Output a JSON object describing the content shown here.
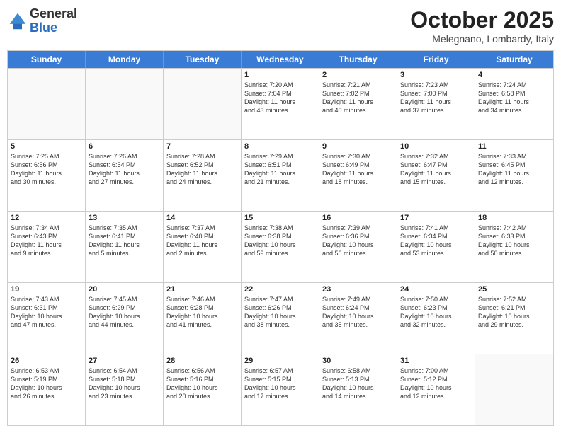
{
  "header": {
    "logo_line1": "General",
    "logo_line2": "Blue",
    "month_title": "October 2025",
    "location": "Melegnano, Lombardy, Italy"
  },
  "weekdays": [
    "Sunday",
    "Monday",
    "Tuesday",
    "Wednesday",
    "Thursday",
    "Friday",
    "Saturday"
  ],
  "weeks": [
    [
      {
        "day": "",
        "info": ""
      },
      {
        "day": "",
        "info": ""
      },
      {
        "day": "",
        "info": ""
      },
      {
        "day": "1",
        "info": "Sunrise: 7:20 AM\nSunset: 7:04 PM\nDaylight: 11 hours\nand 43 minutes."
      },
      {
        "day": "2",
        "info": "Sunrise: 7:21 AM\nSunset: 7:02 PM\nDaylight: 11 hours\nand 40 minutes."
      },
      {
        "day": "3",
        "info": "Sunrise: 7:23 AM\nSunset: 7:00 PM\nDaylight: 11 hours\nand 37 minutes."
      },
      {
        "day": "4",
        "info": "Sunrise: 7:24 AM\nSunset: 6:58 PM\nDaylight: 11 hours\nand 34 minutes."
      }
    ],
    [
      {
        "day": "5",
        "info": "Sunrise: 7:25 AM\nSunset: 6:56 PM\nDaylight: 11 hours\nand 30 minutes."
      },
      {
        "day": "6",
        "info": "Sunrise: 7:26 AM\nSunset: 6:54 PM\nDaylight: 11 hours\nand 27 minutes."
      },
      {
        "day": "7",
        "info": "Sunrise: 7:28 AM\nSunset: 6:52 PM\nDaylight: 11 hours\nand 24 minutes."
      },
      {
        "day": "8",
        "info": "Sunrise: 7:29 AM\nSunset: 6:51 PM\nDaylight: 11 hours\nand 21 minutes."
      },
      {
        "day": "9",
        "info": "Sunrise: 7:30 AM\nSunset: 6:49 PM\nDaylight: 11 hours\nand 18 minutes."
      },
      {
        "day": "10",
        "info": "Sunrise: 7:32 AM\nSunset: 6:47 PM\nDaylight: 11 hours\nand 15 minutes."
      },
      {
        "day": "11",
        "info": "Sunrise: 7:33 AM\nSunset: 6:45 PM\nDaylight: 11 hours\nand 12 minutes."
      }
    ],
    [
      {
        "day": "12",
        "info": "Sunrise: 7:34 AM\nSunset: 6:43 PM\nDaylight: 11 hours\nand 9 minutes."
      },
      {
        "day": "13",
        "info": "Sunrise: 7:35 AM\nSunset: 6:41 PM\nDaylight: 11 hours\nand 5 minutes."
      },
      {
        "day": "14",
        "info": "Sunrise: 7:37 AM\nSunset: 6:40 PM\nDaylight: 11 hours\nand 2 minutes."
      },
      {
        "day": "15",
        "info": "Sunrise: 7:38 AM\nSunset: 6:38 PM\nDaylight: 10 hours\nand 59 minutes."
      },
      {
        "day": "16",
        "info": "Sunrise: 7:39 AM\nSunset: 6:36 PM\nDaylight: 10 hours\nand 56 minutes."
      },
      {
        "day": "17",
        "info": "Sunrise: 7:41 AM\nSunset: 6:34 PM\nDaylight: 10 hours\nand 53 minutes."
      },
      {
        "day": "18",
        "info": "Sunrise: 7:42 AM\nSunset: 6:33 PM\nDaylight: 10 hours\nand 50 minutes."
      }
    ],
    [
      {
        "day": "19",
        "info": "Sunrise: 7:43 AM\nSunset: 6:31 PM\nDaylight: 10 hours\nand 47 minutes."
      },
      {
        "day": "20",
        "info": "Sunrise: 7:45 AM\nSunset: 6:29 PM\nDaylight: 10 hours\nand 44 minutes."
      },
      {
        "day": "21",
        "info": "Sunrise: 7:46 AM\nSunset: 6:28 PM\nDaylight: 10 hours\nand 41 minutes."
      },
      {
        "day": "22",
        "info": "Sunrise: 7:47 AM\nSunset: 6:26 PM\nDaylight: 10 hours\nand 38 minutes."
      },
      {
        "day": "23",
        "info": "Sunrise: 7:49 AM\nSunset: 6:24 PM\nDaylight: 10 hours\nand 35 minutes."
      },
      {
        "day": "24",
        "info": "Sunrise: 7:50 AM\nSunset: 6:23 PM\nDaylight: 10 hours\nand 32 minutes."
      },
      {
        "day": "25",
        "info": "Sunrise: 7:52 AM\nSunset: 6:21 PM\nDaylight: 10 hours\nand 29 minutes."
      }
    ],
    [
      {
        "day": "26",
        "info": "Sunrise: 6:53 AM\nSunset: 5:19 PM\nDaylight: 10 hours\nand 26 minutes."
      },
      {
        "day": "27",
        "info": "Sunrise: 6:54 AM\nSunset: 5:18 PM\nDaylight: 10 hours\nand 23 minutes."
      },
      {
        "day": "28",
        "info": "Sunrise: 6:56 AM\nSunset: 5:16 PM\nDaylight: 10 hours\nand 20 minutes."
      },
      {
        "day": "29",
        "info": "Sunrise: 6:57 AM\nSunset: 5:15 PM\nDaylight: 10 hours\nand 17 minutes."
      },
      {
        "day": "30",
        "info": "Sunrise: 6:58 AM\nSunset: 5:13 PM\nDaylight: 10 hours\nand 14 minutes."
      },
      {
        "day": "31",
        "info": "Sunrise: 7:00 AM\nSunset: 5:12 PM\nDaylight: 10 hours\nand 12 minutes."
      },
      {
        "day": "",
        "info": ""
      }
    ]
  ]
}
